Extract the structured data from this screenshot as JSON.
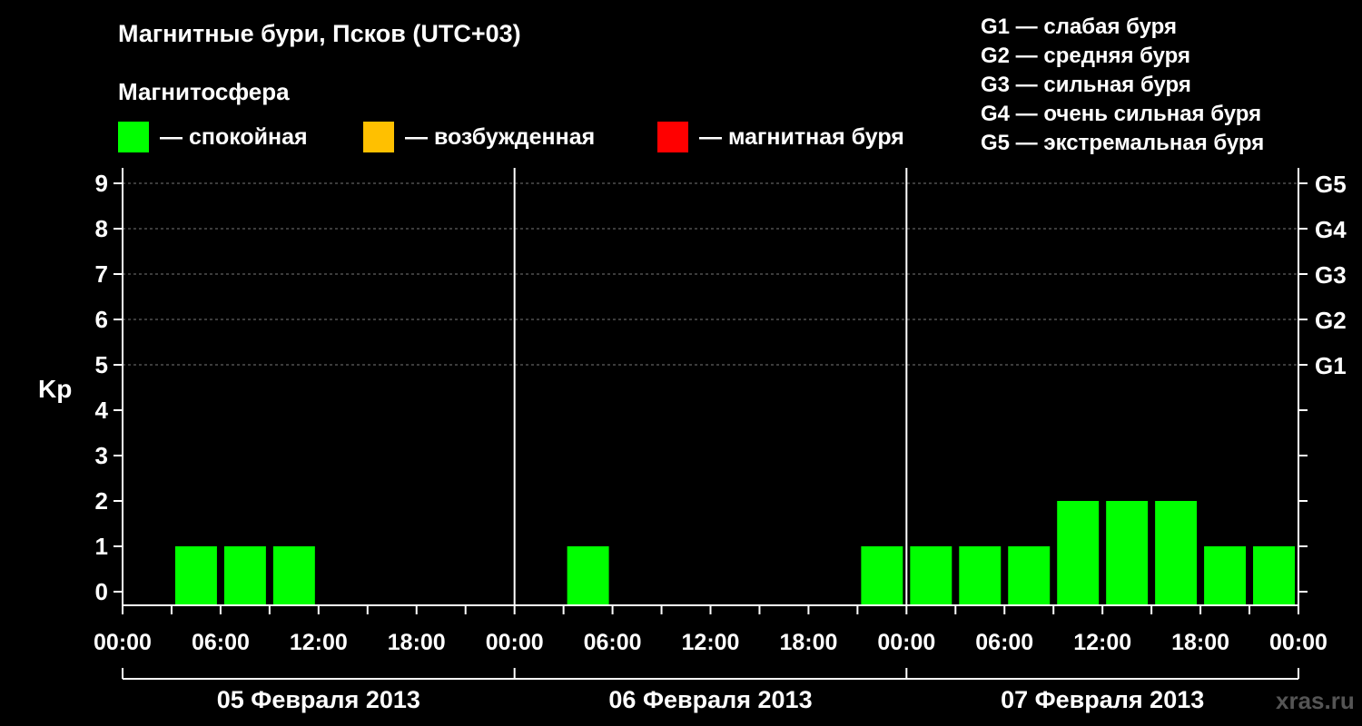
{
  "header": {
    "title": "Магнитные бури, Псков (UTC+03)",
    "subtitle": "Магнитосфера"
  },
  "legend": [
    {
      "color": "#00ff00",
      "label": "— спокойная"
    },
    {
      "color": "#ffc000",
      "label": "— возбужденная"
    },
    {
      "color": "#ff0000",
      "label": "— магнитная буря"
    }
  ],
  "storm_levels": [
    "G1 — слабая буря",
    "G2 — средняя буря",
    "G3 — сильная буря",
    "G4 — очень сильная буря",
    "G5 — экстремальная буря"
  ],
  "watermark": "xras.ru",
  "chart_data": {
    "type": "bar",
    "ylabel": "Kp",
    "ylim": [
      0,
      9
    ],
    "y_ticks": [
      0,
      1,
      2,
      3,
      4,
      5,
      6,
      7,
      8,
      9
    ],
    "right_ticks": [
      {
        "value": 5,
        "label": "G1"
      },
      {
        "value": 6,
        "label": "G2"
      },
      {
        "value": 7,
        "label": "G3"
      },
      {
        "value": 8,
        "label": "G4"
      },
      {
        "value": 9,
        "label": "G5"
      }
    ],
    "x_tick_labels": [
      "00:00",
      "06:00",
      "12:00",
      "18:00",
      "00:00",
      "06:00",
      "12:00",
      "18:00",
      "00:00",
      "06:00",
      "12:00",
      "18:00",
      "00:00"
    ],
    "days": [
      "05 Февраля 2013",
      "06 Февраля 2013",
      "07 Февраля 2013"
    ],
    "interval_hours": 3,
    "colors": {
      "quiet": "#00ff00",
      "active": "#ffc000",
      "storm": "#ff0000"
    },
    "values": [
      0,
      1,
      1,
      1,
      0,
      0,
      0,
      0,
      0,
      1,
      0,
      0,
      0,
      0,
      0,
      1,
      1,
      1,
      1,
      2,
      2,
      2,
      1,
      1
    ]
  }
}
